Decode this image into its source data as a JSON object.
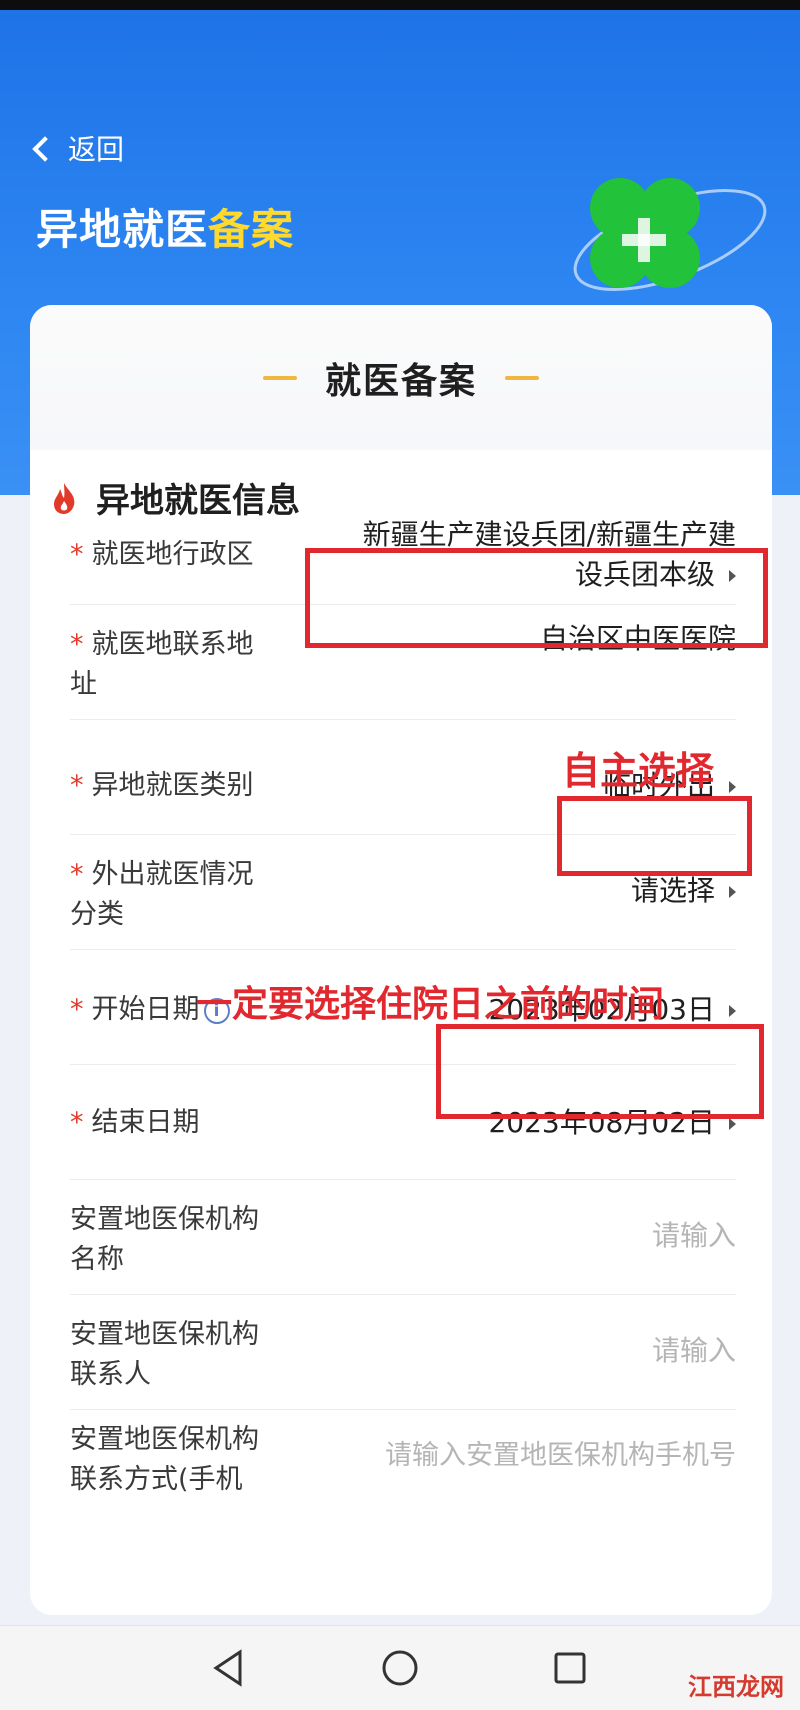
{
  "header": {
    "back_label": "返回",
    "title_main": "异地就医",
    "title_highlight": "备案"
  },
  "card": {
    "header_title": "就医备案",
    "section_title": "异地就医信息"
  },
  "form": {
    "region": {
      "label": "就医地行政区",
      "value_line1": "新疆生产建设兵团/新疆生产建",
      "value_line2": "设兵团本级"
    },
    "address": {
      "label_line1": "就医地联系地",
      "label_line2": "址",
      "value": "自治区中医医院"
    },
    "category": {
      "label": "异地就医类别",
      "value": "临时外出"
    },
    "situation": {
      "label_line1": "外出就医情况",
      "label_line2": "分类",
      "value": "请选择"
    },
    "start_date": {
      "label": "开始日期",
      "value": "2023年02月03日"
    },
    "end_date": {
      "label": "结束日期",
      "value": "2023年08月02日"
    },
    "agency_name": {
      "label_line1": "安置地医保机构",
      "label_line2": "名称",
      "placeholder": "请输入"
    },
    "agency_contact": {
      "label_line1": "安置地医保机构",
      "label_line2": "联系人",
      "placeholder": "请输入"
    },
    "agency_phone": {
      "label_line1": "安置地医保机构",
      "label_line2": "联系方式(手机",
      "placeholder": "请输入安置地医保机构手机号"
    }
  },
  "annotations": {
    "self_select": "自主选择",
    "before_admission": "一定要选择住院日之前的时间"
  },
  "watermark": "江西龙网",
  "required_mark": "*",
  "colors": {
    "header_blue": "#1e72e6",
    "title_highlight": "#ffd92e",
    "annotation_red": "#e0282e",
    "required_red": "#e23a2a",
    "accent_gold": "#f0b740"
  }
}
